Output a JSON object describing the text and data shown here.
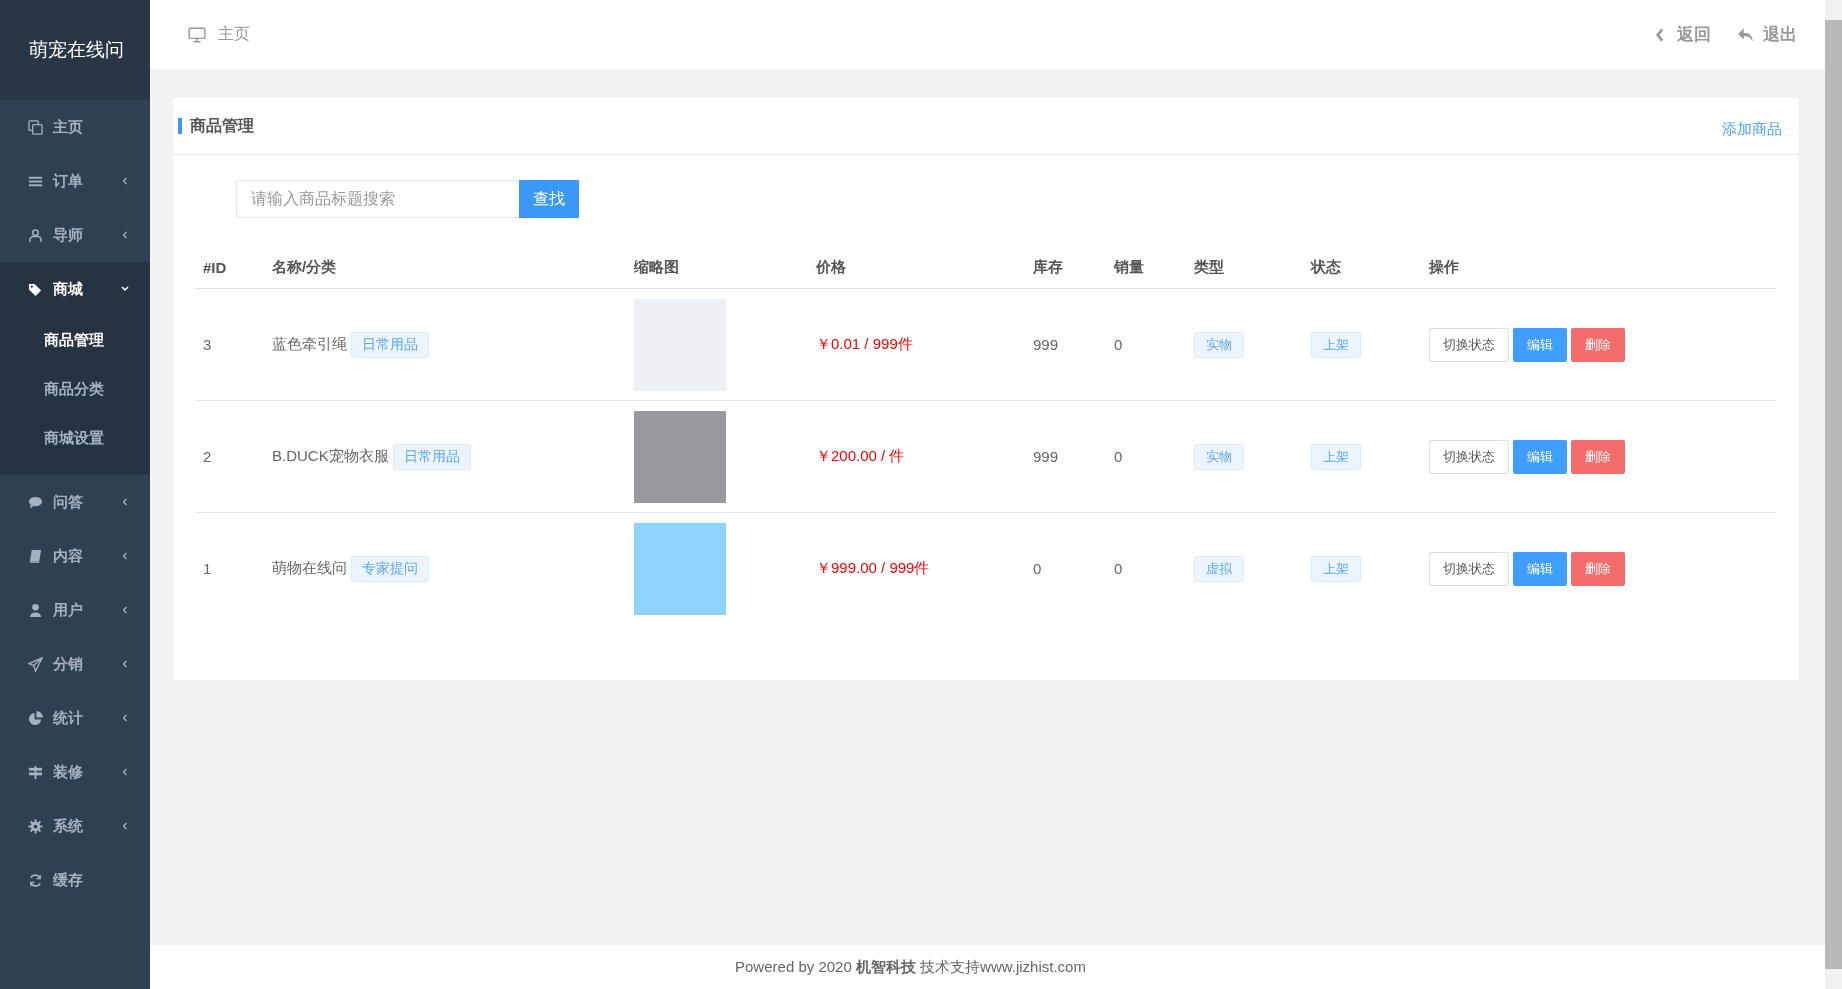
{
  "sidebar": {
    "logo": "萌宠在线问",
    "items": [
      {
        "label": "主页",
        "expandable": false,
        "expanded": false
      },
      {
        "label": "订单",
        "expandable": true,
        "expanded": false
      },
      {
        "label": "导师",
        "expandable": true,
        "expanded": false
      },
      {
        "label": "商城",
        "expandable": true,
        "expanded": true,
        "children": [
          {
            "label": "商品管理",
            "selected": true
          },
          {
            "label": "商品分类",
            "selected": false
          },
          {
            "label": "商城设置",
            "selected": false
          }
        ]
      },
      {
        "label": "问答",
        "expandable": true,
        "expanded": false
      },
      {
        "label": "内容",
        "expandable": true,
        "expanded": false
      },
      {
        "label": "用户",
        "expandable": true,
        "expanded": false
      },
      {
        "label": "分销",
        "expandable": true,
        "expanded": false
      },
      {
        "label": "统计",
        "expandable": true,
        "expanded": false
      },
      {
        "label": "装修",
        "expandable": true,
        "expanded": false
      },
      {
        "label": "系统",
        "expandable": true,
        "expanded": false
      },
      {
        "label": "缓存",
        "expandable": false,
        "expanded": false
      }
    ]
  },
  "header": {
    "breadcrumb": "主页",
    "back": "返回",
    "logout": "退出"
  },
  "panel": {
    "title": "商品管理",
    "add_link": "添加商品",
    "search": {
      "placeholder": "请输入商品标题搜索",
      "button": "查找"
    }
  },
  "table": {
    "columns": [
      "#ID",
      "名称/分类",
      "缩略图",
      "价格",
      "库存",
      "销量",
      "类型",
      "状态",
      "操作"
    ],
    "rows": [
      {
        "id": "3",
        "name": "蓝色牵引绳",
        "category": "日常用品",
        "price": "￥0.01 / 999件",
        "stock": "999",
        "sales": "0",
        "type": "实物",
        "status": "上架",
        "actions": [
          "切换状态",
          "编辑",
          "删除"
        ]
      },
      {
        "id": "2",
        "name": "B.DUCK宠物衣服",
        "category": "日常用品",
        "price": "￥200.00 / 件",
        "stock": "999",
        "sales": "0",
        "type": "实物",
        "status": "上架",
        "actions": [
          "切换状态",
          "编辑",
          "删除"
        ]
      },
      {
        "id": "1",
        "name": "萌物在线问",
        "category": "专家提问",
        "price": "￥999.00 / 999件",
        "stock": "0",
        "sales": "0",
        "type": "虚拟",
        "status": "上架",
        "actions": [
          "切换状态",
          "编辑",
          "删除"
        ]
      }
    ]
  },
  "footer": "Powered by 2020 **机智科技** 技术支持www.jizhist.com"
}
